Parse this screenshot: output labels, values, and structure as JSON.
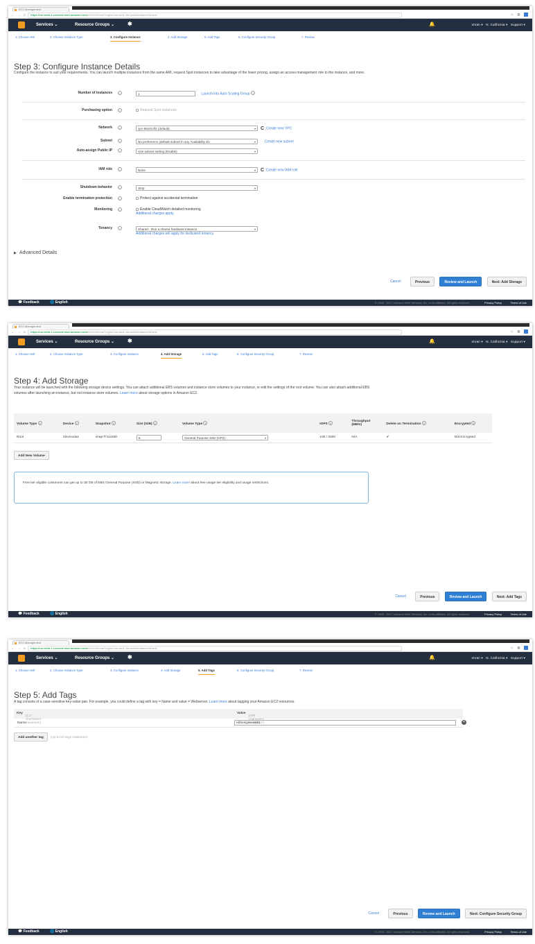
{
  "browser": {
    "tab_title": "EC2 Management",
    "url_host": "https://us-west-1.console.aws.amazon.com",
    "url_path": "/ec2/v2/home?region=us-west-1#LaunchInstanceWizard:"
  },
  "topbar": {
    "services": "Services ⌄",
    "resource_groups": "Resource Groups ⌄",
    "user": "Imran ▾",
    "region": "N. California ▾",
    "support": "Support ▾"
  },
  "wizard_steps": [
    "1. Choose AMI",
    "2. Choose Instance Type",
    "3. Configure Instance",
    "4. Add Storage",
    "5. Add Tags",
    "6. Configure Security Group",
    "7. Review"
  ],
  "step3": {
    "title": "Step 3: Configure Instance Details",
    "description": "Configure the instance to suit your requirements. You can launch multiple instances from the same AMI, request Spot instances to take advantage of the lower pricing, assign an access management role to the instance, and more.",
    "num_instances_label": "Number of instances",
    "num_instances_value": "1",
    "asg_link": "Launch into Auto Scaling Group",
    "purchasing_label": "Purchasing option",
    "purchasing_value": "Request Spot instances",
    "network_label": "Network",
    "network_value": "vpc-9610c2f2 (default)",
    "network_link": "Create new VPC",
    "subnet_label": "Subnet",
    "subnet_value": "No preference (default subnet in any Availability Zo",
    "subnet_link": "Create new subnet",
    "public_ip_label": "Auto-assign Public IP",
    "public_ip_value": "Use subnet setting (Enable)",
    "iam_label": "IAM role",
    "iam_value": "None",
    "iam_link": "Create new IAM role",
    "shutdown_label": "Shutdown behavior",
    "shutdown_value": "Stop",
    "termination_label": "Enable termination protection",
    "termination_value": "Protect against accidental termination",
    "monitoring_label": "Monitoring",
    "monitoring_value": "Enable CloudWatch detailed monitoring",
    "monitoring_note": "Additional charges apply.",
    "tenancy_label": "Tenancy",
    "tenancy_value": "Shared - Run a shared hardware instance",
    "tenancy_note": "Additional charges will apply for dedicated tenancy.",
    "advanced": "Advanced Details",
    "next": "Next: Add Storage"
  },
  "step4": {
    "title": "Step 4: Add Storage",
    "description_1": "Your instance will be launched with the following storage device settings. You can attach additional EBS volumes and instance store volumes to your instance,",
    "description_2": "or edit the settings of the root volume. You can also attach additional EBS volumes after launching an instance, but not instance store volumes.",
    "description_link": "Learn more",
    "description_3": "about storage options in Amazon EC2.",
    "columns": [
      "Volume Type",
      "Device",
      "Snapshot",
      "Size (GiB)",
      "Volume Type",
      "IOPS",
      "Throughput (MB/s)",
      "Delete on Termination",
      "Encrypted"
    ],
    "row": {
      "volume": "Root",
      "device": "/dev/xvda1",
      "snapshot": "snap-f711c830",
      "size": "8",
      "type": "General Purpose SSD (GP2)",
      "iops": "100 / 3000",
      "throughput": "N/A",
      "delete": "✔",
      "encrypted": "Not Encrypted"
    },
    "add_volume": "Add New Volume",
    "free_tier_1": "Free tier eligible customers can get up to 30 GB of EBS General Purpose (SSD) or Magnetic storage.",
    "free_tier_link": "Learn more",
    "free_tier_2": "about free usage tier eligibility and usage restrictions.",
    "next": "Next: Add Tags"
  },
  "step5": {
    "title": "Step 5: Add Tags",
    "description": "A tag consists of a case-sensitive key-value pair. For example, you could define a tag with key = Name and value = Webserver.",
    "description_link": "Learn more",
    "description_2": "about tagging your Amazon EC2 resources.",
    "key_label": "Key",
    "key_hint": "(127 characters maximum)",
    "value_label": "Value",
    "value_hint": "(255 characters maximum)",
    "tag_key": "Name",
    "tag_value": "ebbesigns-web1",
    "add_tag": "Add another tag",
    "add_tag_hint": "(Up to 50 tags maximum)",
    "next": "Next: Configure Security Group"
  },
  "buttons": {
    "cancel": "Cancel",
    "previous": "Previous",
    "review": "Review and Launch"
  },
  "footer": {
    "feedback": "Feedback",
    "language": "English",
    "copyright": "© 2008 - 2017, Amazon Web Services, Inc. or its affiliates. All rights reserved.",
    "privacy": "Privacy Policy",
    "terms": "Terms of Use"
  }
}
